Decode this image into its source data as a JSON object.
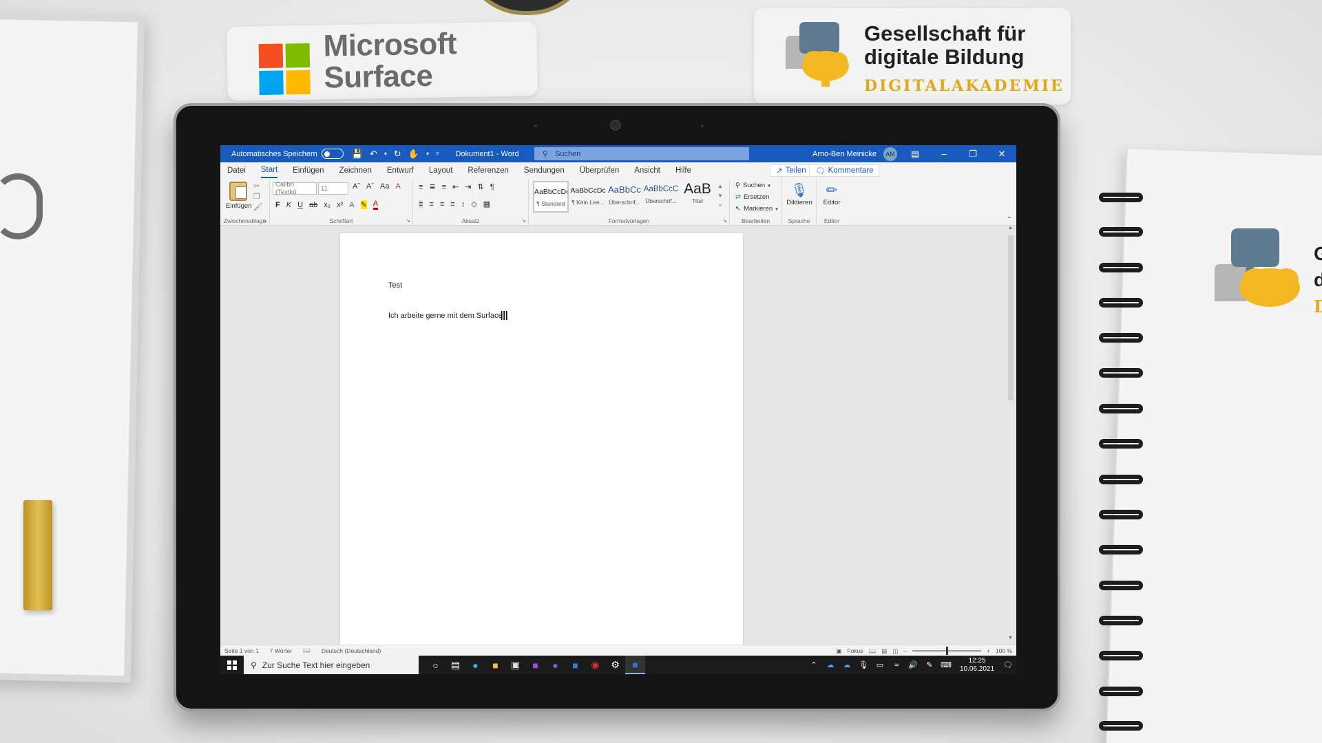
{
  "branding": {
    "ms_line1": "Microsoft",
    "ms_line2": "Surface",
    "gdb_line1": "Gesellschaft für",
    "gdb_line2": "digitale Bildung",
    "gdb_sub": "DIGITALAKADEMIE",
    "nb_letter1": "G",
    "nb_letter2": "di",
    "nb_letter3": "D"
  },
  "titlebar": {
    "autosave": "Automatisches Speichern",
    "doc_title": "Dokument1  -  Word",
    "search": "Suchen",
    "user": "Arno-Ben Meinicke",
    "initials": "AM"
  },
  "tabs": [
    "Datei",
    "Start",
    "Einfügen",
    "Zeichnen",
    "Entwurf",
    "Layout",
    "Referenzen",
    "Sendungen",
    "Überprüfen",
    "Ansicht",
    "Hilfe"
  ],
  "share_label": "Teilen",
  "comments_label": "Kommentare",
  "ribbon": {
    "clipboard": "Zwischenablage",
    "paste": "Einfügen",
    "font_group": "Schriftart",
    "font_name": "Calibri (Textkö",
    "font_size": "11",
    "paragraph": "Absatz",
    "styles_group": "Formatvorlagen",
    "styles": [
      {
        "sample": "AaBbCcDc",
        "name": "¶ Standard"
      },
      {
        "sample": "AaBbCcDc",
        "name": "¶ Kein Lee..."
      },
      {
        "sample": "AaBbCc",
        "name": "Überschrif..."
      },
      {
        "sample": "AaBbCcC",
        "name": "Überschrif..."
      },
      {
        "sample": "AaB",
        "name": "Titel"
      }
    ],
    "edit_group": "Bearbeiten",
    "find": "Suchen",
    "replace": "Ersetzen",
    "select": "Markieren",
    "voice_group": "Sprache",
    "dictate": "Diktieren",
    "editor_group": "Editor",
    "editor": "Editor"
  },
  "document": {
    "line1": "Test",
    "line2": "Ich arbeite gerne mit dem Surface"
  },
  "statusbar": {
    "page": "Seite 1 von 1",
    "words": "7 Wörter",
    "language": "Deutsch (Deutschland)",
    "focus": "Fokus",
    "zoom": "100 %"
  },
  "taskbar": {
    "search_placeholder": "Zur Suche Text hier eingeben",
    "time": "12:25",
    "date": "10.06.2021"
  },
  "colors": {
    "word_blue": "#185abd",
    "ms_red": "#f25022",
    "ms_green": "#7fba00",
    "ms_blue": "#00a4ef",
    "ms_yellow": "#ffb900",
    "gdb_yellow": "#f4b822"
  }
}
